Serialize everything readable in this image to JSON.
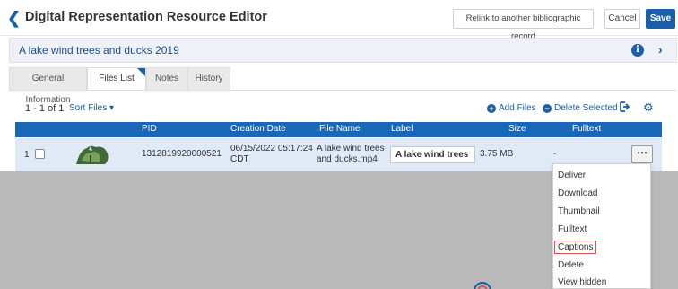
{
  "header": {
    "title": "Digital Representation Resource Editor",
    "relink_label": "Relink to another bibliographic record",
    "cancel_label": "Cancel",
    "save_label": "Save"
  },
  "record": {
    "title": "A lake wind trees and ducks 2019"
  },
  "tabs": [
    {
      "label": "General Information",
      "active": false
    },
    {
      "label": "Files List",
      "active": true
    },
    {
      "label": "Notes",
      "active": false
    },
    {
      "label": "History",
      "active": false
    }
  ],
  "toolbar": {
    "count": "1 - 1 of 1",
    "sort_label": "Sort Files",
    "add_files_label": "Add Files",
    "delete_selected_label": "Delete Selected"
  },
  "table": {
    "columns": [
      "PID",
      "Creation Date",
      "File Name",
      "Label",
      "Size",
      "Fulltext"
    ],
    "rows": [
      {
        "num": "1",
        "pid": "1312819920000521",
        "creation_date_line1": "06/15/2022 05:17:24",
        "creation_date_line2": "CDT",
        "file_name_line1": "A lake wind trees",
        "file_name_line2": "and ducks.mp4",
        "label": "A lake wind trees an",
        "size": "3.75 MB",
        "fulltext": "-"
      }
    ]
  },
  "menu": {
    "items": [
      "Deliver",
      "Download",
      "Thumbnail",
      "Fulltext",
      "Captions",
      "Delete",
      "View hidden"
    ],
    "highlighted": "Captions"
  },
  "colors": {
    "accent": "#1a5fa8",
    "table_header": "#1a67b8",
    "row_selected": "#dfeaf6",
    "overlay": "#b9b9b9",
    "highlight_border": "#d9534f"
  }
}
